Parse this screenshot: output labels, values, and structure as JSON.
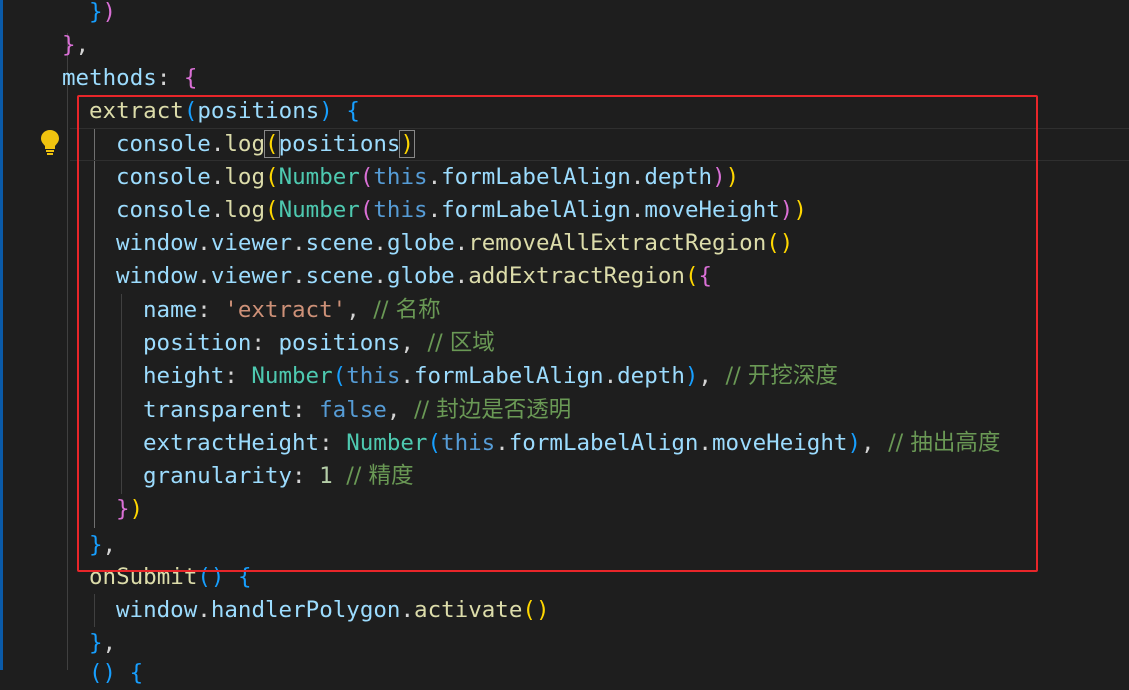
{
  "code": {
    "methods_label": "methods",
    "extract_fn": "extract",
    "param": "positions",
    "console": "console",
    "log": "log",
    "number_cls": "Number",
    "this_kw": "this",
    "formLabelAlign": "formLabelAlign",
    "depth": "depth",
    "moveHeight": "moveHeight",
    "window": "window",
    "viewer": "viewer",
    "scene": "scene",
    "globe": "globe",
    "removeAllExtractRegion": "removeAllExtractRegion",
    "addExtractRegion": "addExtractRegion",
    "name_key": "name",
    "name_value": "'extract'",
    "name_comment": "// 名称",
    "position_key": "position",
    "position_comment": "// 区域",
    "height_key": "height",
    "height_comment": "// 开挖深度",
    "transparent_key": "transparent",
    "false_kw": "false",
    "transparent_comment": "// 封边是否透明",
    "extractHeight_key": "extractHeight",
    "extractHeight_comment": "// 抽出高度",
    "granularity_key": "granularity",
    "granularity_value": "1",
    "granularity_comment": "// 精度",
    "onSubmit_fn": "onSubmit",
    "handlerPolygon": "handlerPolygon",
    "activate": "activate"
  },
  "colors": {
    "background": "#1e1e1e",
    "highlight_box": "#e8262a",
    "lightbulb": "#f0c30f"
  }
}
